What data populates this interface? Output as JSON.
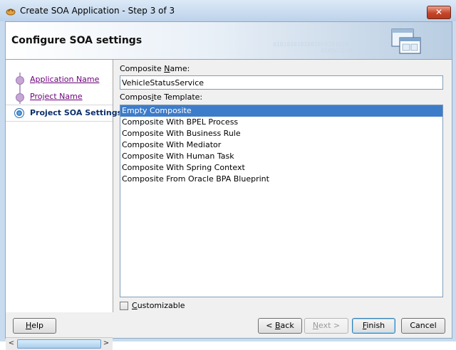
{
  "window": {
    "title": "Create SOA Application - Step 3 of 3",
    "close_glyph": "✕"
  },
  "banner": {
    "title": "Configure SOA settings",
    "bits": "0101010101001010101010\n              010101010"
  },
  "steps": [
    {
      "label": "Application Name"
    },
    {
      "label": "Project Name"
    },
    {
      "label": "Project SOA Settings"
    }
  ],
  "scroll": {
    "left": "<",
    "right": ">"
  },
  "form": {
    "name_label_pre": "Composite ",
    "name_label_acc": "N",
    "name_label_post": "ame:",
    "name_value": "VehicleStatusService",
    "template_label_pre": "Compos",
    "template_label_acc": "i",
    "template_label_post": "te Template:",
    "templates": [
      "Empty Composite",
      "Composite With BPEL Process",
      "Composite With Business Rule",
      "Composite With Mediator",
      "Composite With Human Task",
      "Composite With Spring Context",
      "Composite From Oracle BPA Blueprint"
    ],
    "selected_template": "Empty Composite",
    "customizable_acc": "C",
    "customizable_rest": "ustomizable",
    "customizable_checked": false
  },
  "buttons": {
    "help_acc": "H",
    "help_rest": "elp",
    "back_prefix": "< ",
    "back_acc": "B",
    "back_rest": "ack",
    "next_prefix": "",
    "next_acc": "N",
    "next_rest": "ext >",
    "finish_acc": "F",
    "finish_rest": "inish",
    "cancel": "Cancel"
  },
  "colors": {
    "selection": "#3d7cc9",
    "visited_link": "#6b007a",
    "current_step": "#0c2f6b"
  }
}
